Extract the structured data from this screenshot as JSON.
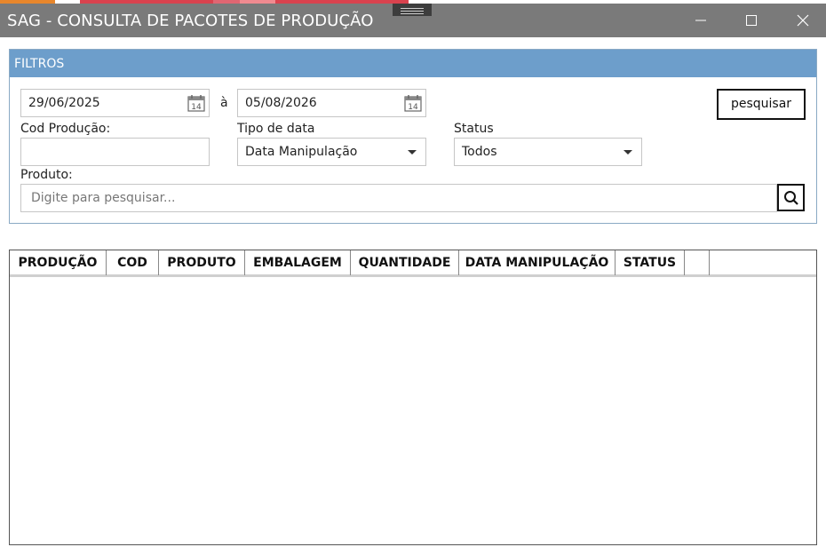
{
  "window": {
    "title": "SAG - CONSULTA DE PACOTES DE PRODUÇÃO"
  },
  "filters": {
    "header": "FILTROS",
    "date_from": "29/06/2025",
    "date_separator": "à",
    "date_to": "05/08/2026",
    "search_button": "pesquisar",
    "cod_producao_label": "Cod Produção:",
    "cod_producao_value": "",
    "tipo_data_label": "Tipo de data",
    "tipo_data_value": "Data Manipulação",
    "status_label": "Status",
    "status_value": "Todos",
    "produto_label": "Produto:",
    "produto_placeholder": "Digite para pesquisar...",
    "calendar_day": "14"
  },
  "grid": {
    "columns": [
      "PRODUÇÃO",
      "COD",
      "PRODUTO",
      "EMBALAGEM",
      "QUANTIDADE",
      "DATA MANIPULAÇÃO",
      "STATUS",
      "",
      ""
    ],
    "rows": []
  },
  "colors": {
    "titlebar": "#7a7a7a",
    "filter_header": "#6d9ecb",
    "panel_border": "#8aa9c4"
  }
}
